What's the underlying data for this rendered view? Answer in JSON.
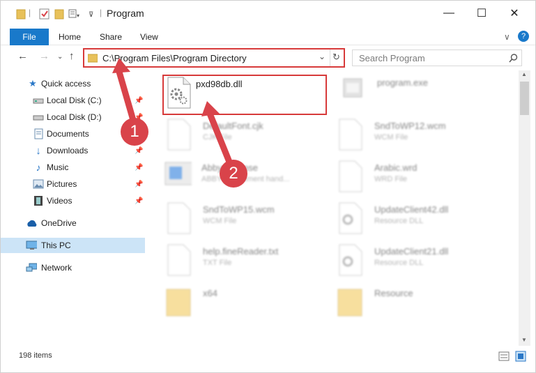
{
  "window": {
    "title": "Program",
    "controls": {
      "minimize": "—",
      "maximize": "☐",
      "close": "✕"
    }
  },
  "ribbon": {
    "tabs": [
      {
        "label": "File"
      },
      {
        "label": "Home"
      },
      {
        "label": "Share"
      },
      {
        "label": "View"
      }
    ],
    "help_icon": "?",
    "expand_icon": "∨"
  },
  "address_bar": {
    "path": "C:\\Program Files\\Program Directory"
  },
  "search": {
    "placeholder": "Search Program"
  },
  "nav_pane": {
    "items": [
      {
        "label": "Quick access",
        "icon": "star-icon"
      },
      {
        "label": "Local Disk (C:)",
        "icon": "drive-icon",
        "pinned": true
      },
      {
        "label": "Local Disk (D:)",
        "icon": "drive-icon",
        "pinned": true
      },
      {
        "label": "Documents",
        "icon": "documents-icon",
        "pinned": true
      },
      {
        "label": "Downloads",
        "icon": "download-icon",
        "pinned": true
      },
      {
        "label": "Music",
        "icon": "music-icon",
        "pinned": true
      },
      {
        "label": "Pictures",
        "icon": "pictures-icon",
        "pinned": true
      },
      {
        "label": "Videos",
        "icon": "videos-icon",
        "pinned": true
      },
      {
        "label": "OneDrive",
        "icon": "cloud-icon"
      },
      {
        "label": "This PC",
        "icon": "computer-icon",
        "selected": true
      },
      {
        "label": "Network",
        "icon": "network-icon"
      }
    ]
  },
  "files": [
    {
      "name": "pxd98db.dll",
      "type": "",
      "icon": "dll-gear-icon",
      "highlighted": true
    },
    {
      "name": "program.exe",
      "type": "",
      "icon": "exe-icon"
    },
    {
      "name": "DefaultFont.cjk",
      "type": "CJK File",
      "icon": "blank-file-icon"
    },
    {
      "name": "SndToWP12.wcm",
      "type": "WCM File",
      "icon": "blank-file-icon"
    },
    {
      "name": "AbbyyLicense",
      "type": "ABBYY Document hand...",
      "icon": "window-file-icon"
    },
    {
      "name": "Arabic.wrd",
      "type": "WRD File",
      "icon": "blank-file-icon"
    },
    {
      "name": "SndToWP15.wcm",
      "type": "WCM File",
      "icon": "blank-file-icon"
    },
    {
      "name": "UpdateClient42.dll",
      "type": "Resource DLL",
      "icon": "dll-gear-icon"
    },
    {
      "name": "help.fineReader.txt",
      "type": "TXT File",
      "icon": "blank-file-icon"
    },
    {
      "name": "UpdateClient21.dll",
      "type": "Resource DLL",
      "icon": "dll-gear-icon"
    },
    {
      "name": "x64",
      "type": "",
      "icon": "folder-icon"
    },
    {
      "name": "Resource",
      "type": "",
      "icon": "folder-icon"
    }
  ],
  "status_bar": {
    "item_count": "198 items"
  },
  "annotations": {
    "step1": "1",
    "step2": "2",
    "accent": "#d9434a"
  }
}
